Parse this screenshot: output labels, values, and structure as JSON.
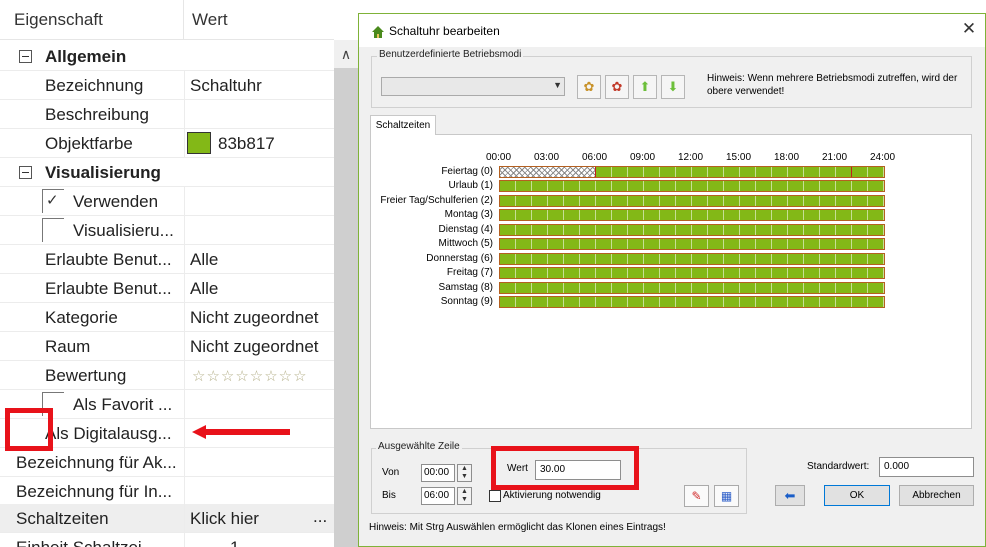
{
  "grid": {
    "header": {
      "property": "Eigenschaft",
      "value": "Wert"
    },
    "rows": [
      {
        "key": "Allgemein",
        "value": ""
      },
      {
        "key": "Bezeichnung",
        "value": "Schaltuhr"
      },
      {
        "key": "Beschreibung",
        "value": ""
      },
      {
        "key": "Objektfarbe",
        "value": "83b817"
      },
      {
        "key": "Visualisierung",
        "value": ""
      },
      {
        "key": "Verwenden",
        "value": ""
      },
      {
        "key": "Visualisieru...",
        "value": ""
      },
      {
        "key": "Erlaubte Benut...",
        "value": "Alle"
      },
      {
        "key": "Erlaubte Benut...",
        "value": "Alle"
      },
      {
        "key": "Kategorie",
        "value": "Nicht zugeordnet"
      },
      {
        "key": "Raum",
        "value": "Nicht zugeordnet"
      },
      {
        "key": "Bewertung",
        "value": "☆☆☆☆☆☆☆☆"
      },
      {
        "key": "Als Favorit ...",
        "value": ""
      },
      {
        "key": "Als Digitalausg...",
        "value": ""
      },
      {
        "key": "Bezeichnung für Ak...",
        "value": ""
      },
      {
        "key": "Bezeichnung für In...",
        "value": ""
      },
      {
        "key": "Schaltzeiten",
        "value": "Klick hier",
        "extra": "..."
      },
      {
        "key": "Einheit Schaltzei...",
        "value": "1"
      }
    ],
    "verwenden_check": "✓",
    "object_color": "#83b817"
  },
  "dialog": {
    "title": "Schaltuhr bearbeiten",
    "close": "✕",
    "modes_legend": "Benutzerdefinierte Betriebsmodi",
    "modes_hint": "Hinweis: Wenn mehrere Betriebsmodi zutreffen, wird der obere verwendet!",
    "tab": "Schaltzeiten",
    "hours": [
      "00:00",
      "03:00",
      "06:00",
      "09:00",
      "12:00",
      "15:00",
      "18:00",
      "21:00",
      "24:00"
    ],
    "day_rows": [
      "Feiertag (0)",
      "Urlaub (1)",
      "Freier Tag/Schulferien (2)",
      "Montag (3)",
      "Dienstag (4)",
      "Mittwoch (5)",
      "Donnerstag (6)",
      "Freitag (7)",
      "Samstag (8)",
      "Sonntag (9)"
    ],
    "selected": {
      "legend": "Ausgewählte Zeile",
      "from_label": "Von",
      "from_value": "00:00",
      "to_label": "Bis",
      "to_value": "06:00",
      "value_label": "Wert",
      "value": "30.00",
      "activation_label": "Aktivierung notwendig"
    },
    "default_label": "Standardwert:",
    "default_value": "0.000",
    "ok": "OK",
    "cancel": "Abbrechen",
    "status": "Hinweis: Mit Strg Auswählen ermöglicht das Klonen eines Eintrags!"
  }
}
